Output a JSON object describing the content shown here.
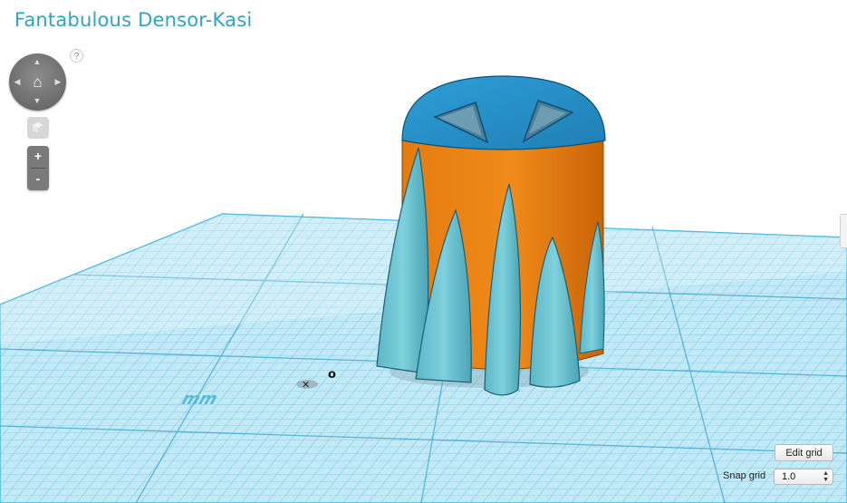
{
  "app": {
    "title": "Fantabulous Densor-Kasi"
  },
  "help": {
    "label": "?",
    "icon": "help-icon"
  },
  "nav_pad": {
    "up": "▲",
    "down": "▼",
    "left": "◀",
    "right": "▶",
    "home": "⌂",
    "icons": [
      "arrow-up-icon",
      "arrow-down-icon",
      "arrow-left-icon",
      "arrow-right-icon",
      "home-icon"
    ]
  },
  "view_cube": {
    "icon": "cube-icon"
  },
  "zoom": {
    "in_label": "+",
    "out_label": "-"
  },
  "viewport": {
    "origin_x_label": "✕",
    "origin_o_label": "o",
    "units_label": "mm",
    "colors": {
      "grid_plane": "#c3e9f6",
      "grid_line": "#3fb4dc",
      "cap": "#2e93c9",
      "body": "#e0760f",
      "spikes": "#6ac3d1"
    }
  },
  "grid_controls": {
    "edit_grid_label": "Edit grid",
    "snap_grid_label": "Snap grid",
    "snap_grid_value": "1.0"
  }
}
